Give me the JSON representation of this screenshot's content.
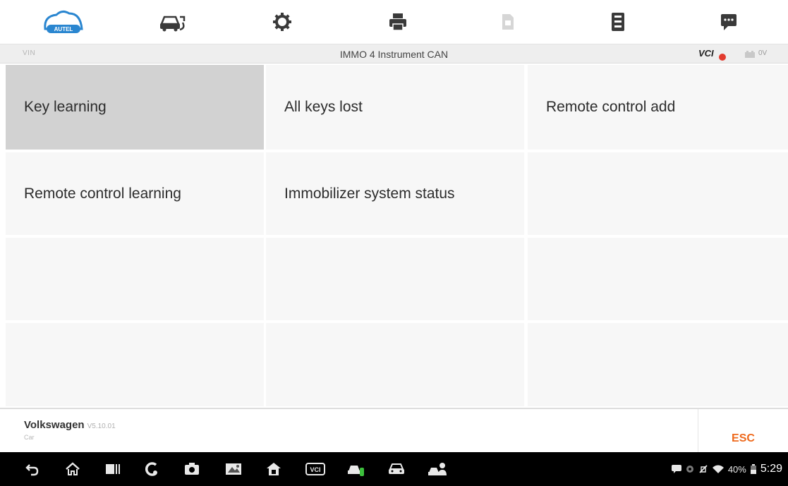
{
  "toolbar": {
    "logo_text": "AUTEL",
    "items": [
      "autel-logo",
      "vehicle-swap-icon",
      "settings-gear-icon",
      "print-icon",
      "pdf-icon",
      "data-logging-icon",
      "message-icon"
    ]
  },
  "info_bar": {
    "vin_label": "VIN",
    "title": "IMMO 4 Instrument CAN",
    "vci_label": "VCI",
    "battery_voltage": "0V"
  },
  "menu": {
    "items": [
      {
        "label": "Key learning",
        "selected": true
      },
      {
        "label": "All keys lost",
        "selected": false
      },
      {
        "label": "Remote control add",
        "selected": false
      },
      {
        "label": "Remote control learning",
        "selected": false
      },
      {
        "label": "Immobilizer system status",
        "selected": false
      }
    ]
  },
  "footer": {
    "make": "Volkswagen",
    "version": "V5.10.01",
    "category": "Car",
    "esc_label": "ESC"
  },
  "status_bar": {
    "battery_percent": "40%",
    "time": "5:29"
  },
  "colors": {
    "accent_blue": "#2a86d0",
    "esc_orange": "#ee6a1d",
    "selected_cell": "#d2d2d2",
    "cell_bg": "#f7f7f7",
    "vci_disconnected": "#e23b2e"
  }
}
